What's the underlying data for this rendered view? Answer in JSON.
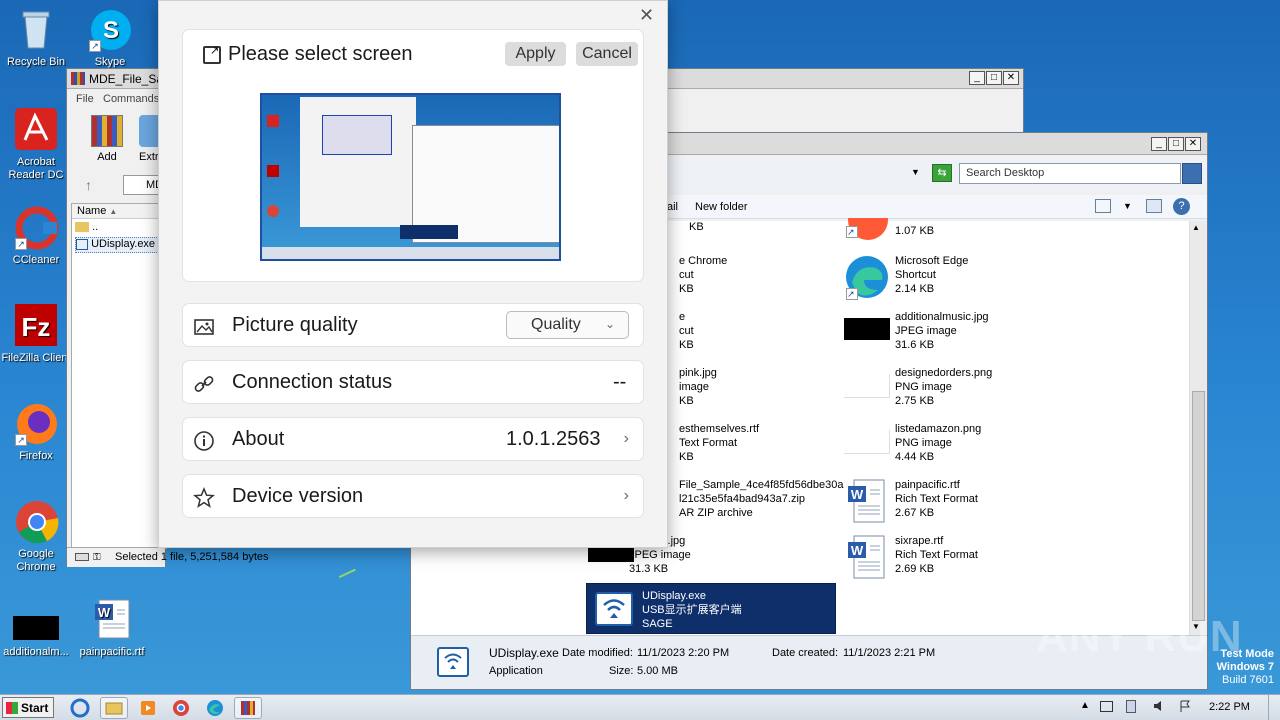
{
  "desktop": {
    "icons": [
      {
        "label": "Recycle Bin"
      },
      {
        "label": "Skype"
      },
      {
        "label": "Acrobat Reader DC"
      },
      {
        "label": "CCleaner"
      },
      {
        "label": "FileZilla Client"
      },
      {
        "label": "Firefox"
      },
      {
        "label": "Google Chrome"
      },
      {
        "label": "additionalm..."
      },
      {
        "label": "painpacific.rtf"
      }
    ]
  },
  "winrar": {
    "title": "MDE_File_Sa",
    "menu": [
      "File",
      "Commands"
    ],
    "toolbar": [
      "Add",
      "Extr"
    ],
    "path_fragment": "MD",
    "col_name": "Name",
    "rows": [
      "..",
      "UDisplay.exe"
    ],
    "status": "Selected 1 file, 5,251,584 bytes"
  },
  "explorer": {
    "search_placeholder": "Search Desktop",
    "toolbar_partial": "ail",
    "new_folder": "New folder",
    "items_left": [
      {
        "l1": "",
        "l2": "",
        "l3": "KB"
      },
      {
        "l1": "e Chrome",
        "l2": "cut",
        "l3": "KB"
      },
      {
        "l1": "e",
        "l2": "cut",
        "l3": "KB"
      },
      {
        "l1": "pink.jpg",
        "l2": "image",
        "l3": "KB"
      },
      {
        "l1": "esthemselves.rtf",
        "l2": "Text Format",
        "l3": "KB"
      },
      {
        "l1": "File_Sample_4ce4f85fd56dbe30a",
        "l2": "l21c35e5fa4bad943a7.zip",
        "l3": "AR ZIP archive"
      },
      {
        "l1": "ngloans.jpg",
        "l2": "JPEG image",
        "l3": "31.3 KB"
      }
    ],
    "items_right": [
      {
        "l1": "",
        "l2": "",
        "l3": "1.07 KB"
      },
      {
        "l1": "Microsoft Edge",
        "l2": "Shortcut",
        "l3": "2.14 KB"
      },
      {
        "l1": "additionalmusic.jpg",
        "l2": "JPEG image",
        "l3": "31.6 KB"
      },
      {
        "l1": "designedorders.png",
        "l2": "PNG image",
        "l3": "2.75 KB"
      },
      {
        "l1": "listedamazon.png",
        "l2": "PNG image",
        "l3": "4.44 KB"
      },
      {
        "l1": "painpacific.rtf",
        "l2": "Rich Text Format",
        "l3": "2.67 KB"
      },
      {
        "l1": "sixrape.rtf",
        "l2": "Rich Text Format",
        "l3": "2.69 KB"
      }
    ],
    "selected": {
      "l1": "UDisplay.exe",
      "l2": "USB显示扩展客户端",
      "l3": "SAGE"
    },
    "details": {
      "name": "UDisplay.exe",
      "type": "Application",
      "modified_label": "Date modified:",
      "modified": "11/1/2023 2:20 PM",
      "created_label": "Date created:",
      "created": "11/1/2023 2:21 PM",
      "size_label": "Size:",
      "size": "5.00 MB"
    }
  },
  "dialog": {
    "title": "Please select screen",
    "apply": "Apply",
    "cancel": "Cancel",
    "rows": [
      {
        "label": "Picture quality",
        "value": "Quality"
      },
      {
        "label": "Connection status",
        "value": "--"
      },
      {
        "label": "About",
        "value": "1.0.1.2563"
      },
      {
        "label": "Device version",
        "value": ""
      }
    ]
  },
  "watermark": {
    "brand": "ANY RUN",
    "line1": "Test Mode",
    "line2": "Windows 7",
    "line3": "Build 7601"
  },
  "taskbar": {
    "start": "Start",
    "clock": "2:22 PM"
  }
}
